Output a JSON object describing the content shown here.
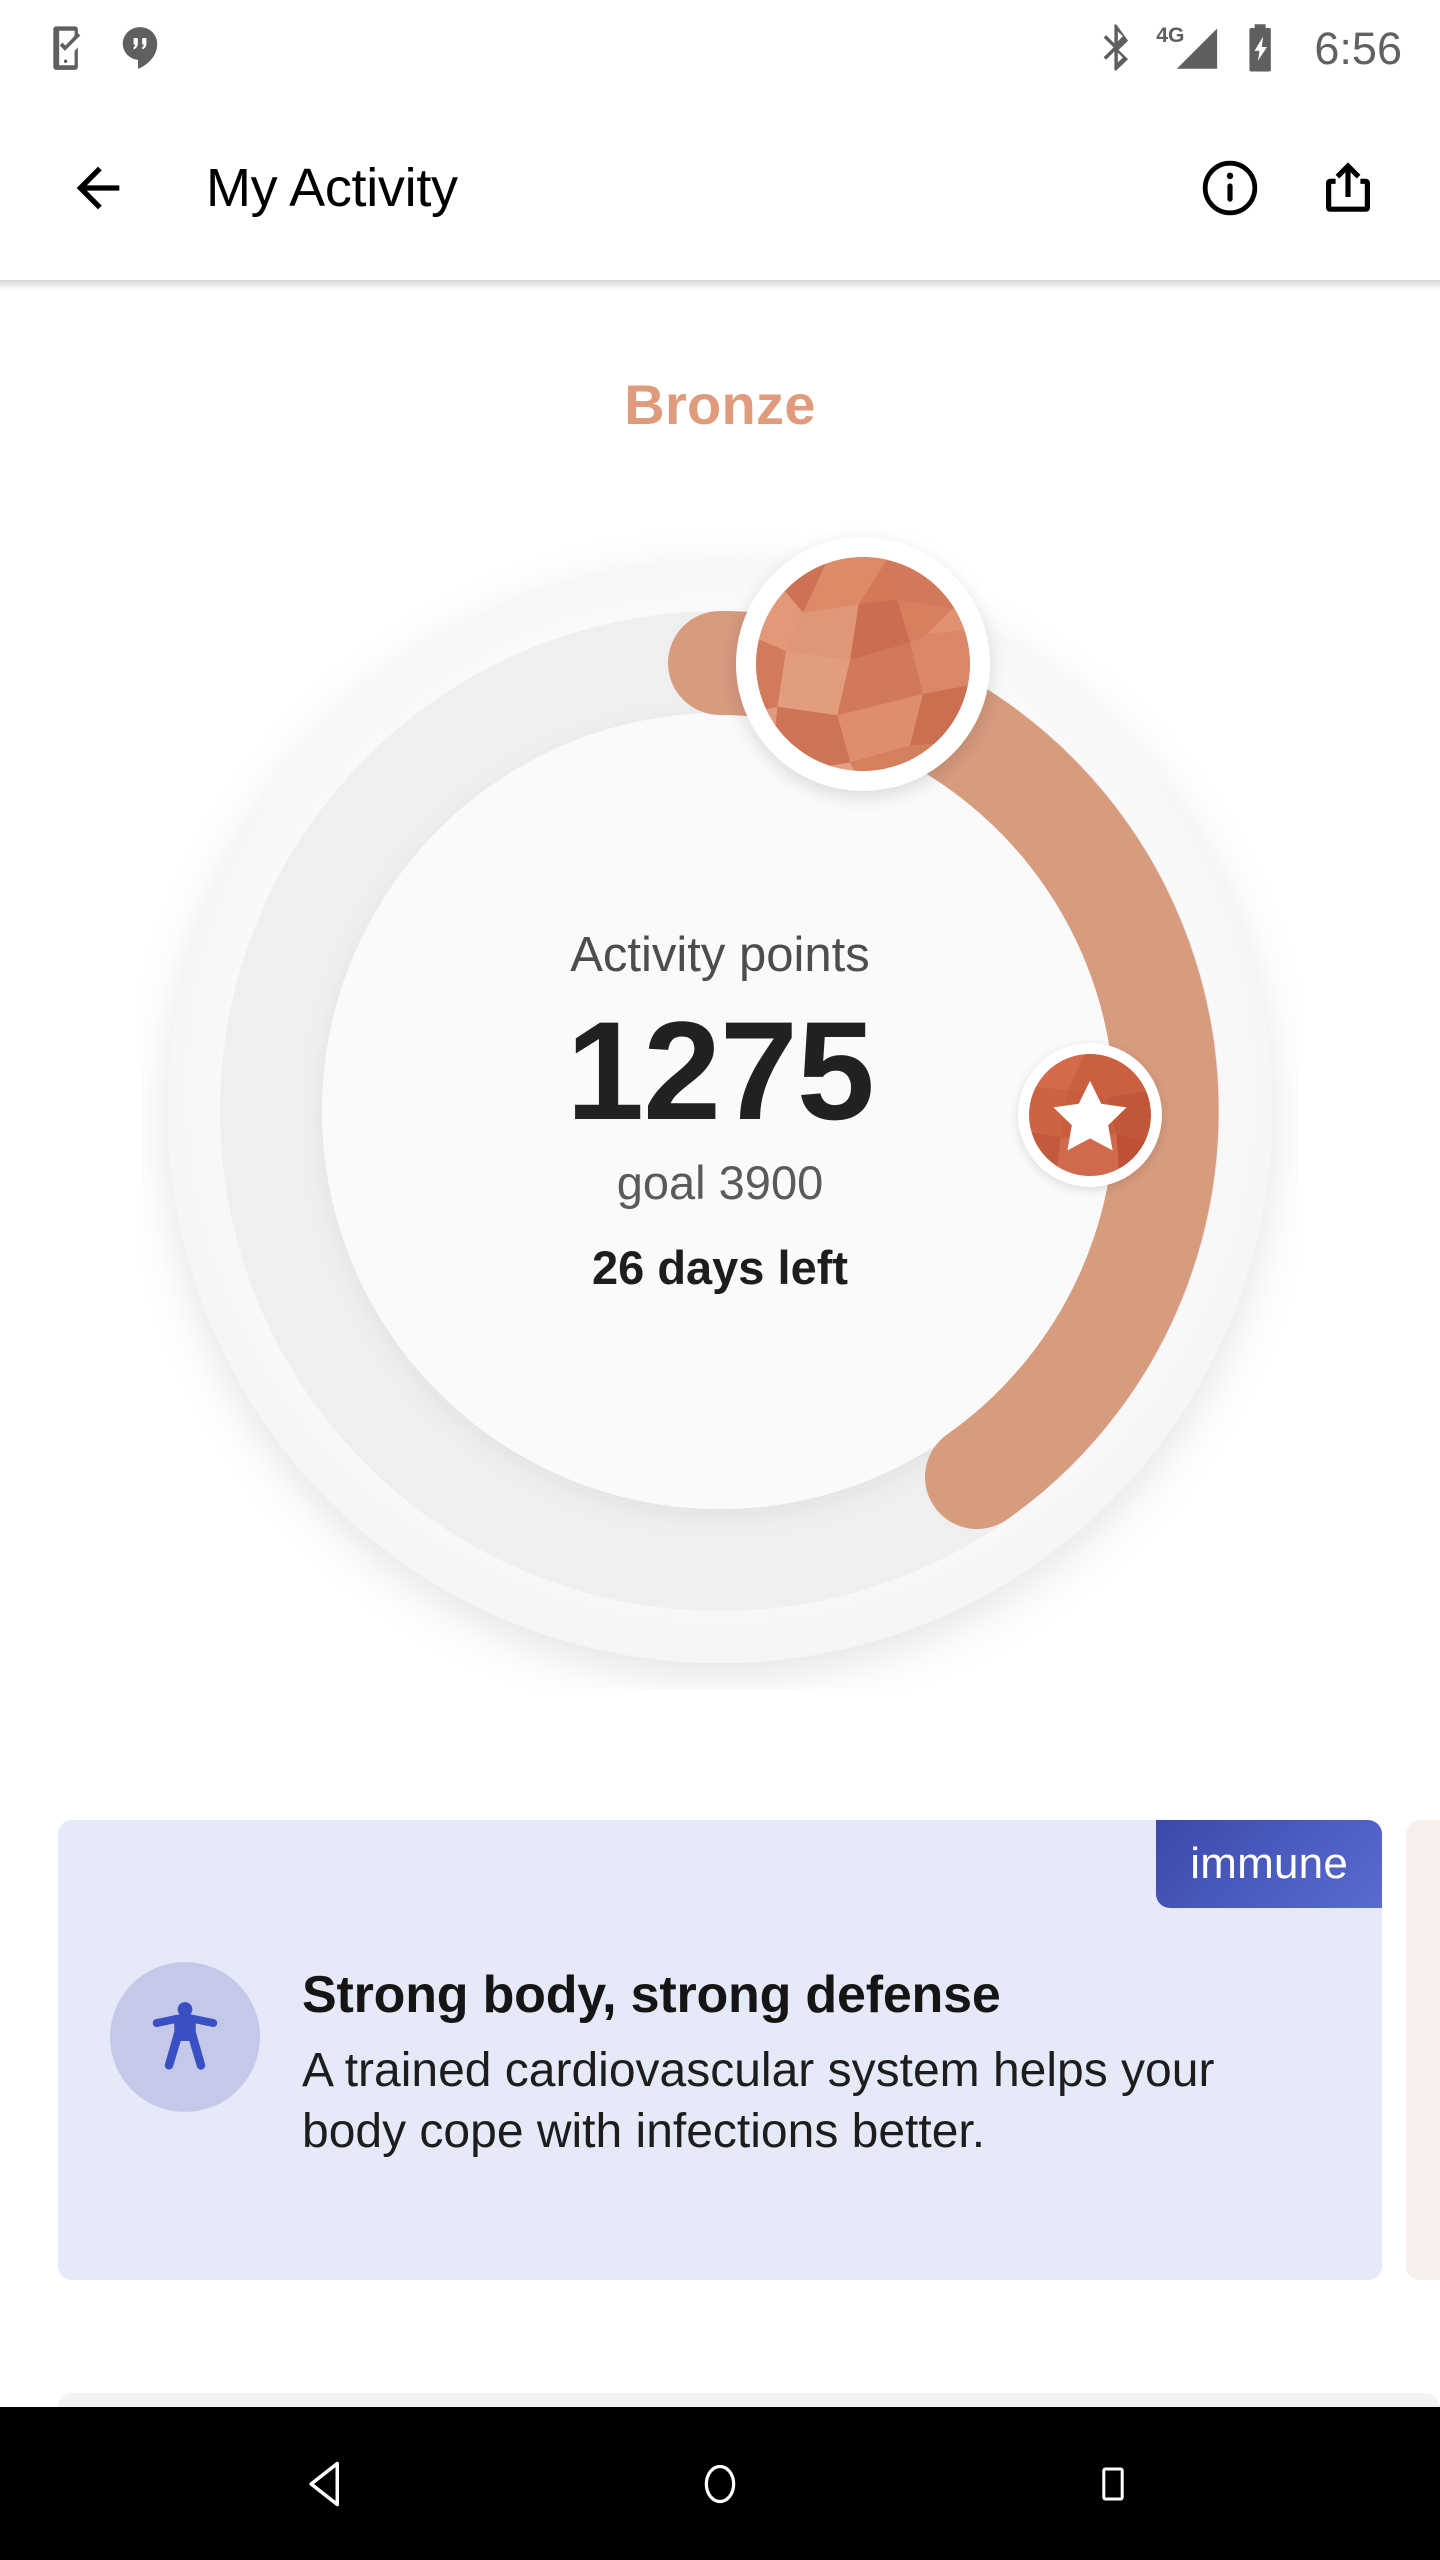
{
  "status_bar": {
    "time": "6:56",
    "notification_icons": [
      {
        "name": "phone-setup-check-icon"
      },
      {
        "name": "hangouts-icon"
      }
    ],
    "system_icons": [
      {
        "name": "bluetooth-icon"
      },
      {
        "name": "network-4g-icon",
        "label": "4G"
      },
      {
        "name": "signal-bars-icon"
      },
      {
        "name": "battery-charging-icon"
      }
    ]
  },
  "app_bar": {
    "back_label": "back-arrow",
    "title": "My Activity",
    "info_label": "info",
    "share_label": "share"
  },
  "activity": {
    "tier": "Bronze",
    "tier_color": "#e09b7c",
    "stat_label": "Activity points",
    "points": "1275",
    "goal": "goal 3900",
    "days_left": "26 days left",
    "progress_percent": 33,
    "arc_color": "#d79b7e",
    "track_color": "#efefef",
    "medal_icon": "bronze-gem-icon",
    "milestone_icon": "star-milestone-icon"
  },
  "cards": [
    {
      "badge": "immune",
      "badge_color": "#3b49ab",
      "background": "#e6e9f7",
      "icon": "accessibility-person-icon",
      "icon_color": "#3a4fc4",
      "title": "Strong body, strong defense",
      "description": "A trained cardiovascular system helps your body cope with infections better."
    },
    {
      "badge": "",
      "background": "#f9efec",
      "icon": "",
      "title": "",
      "description": ""
    }
  ],
  "nav_bar": {
    "back": "nav-back",
    "home": "nav-home",
    "recents": "nav-recents"
  }
}
